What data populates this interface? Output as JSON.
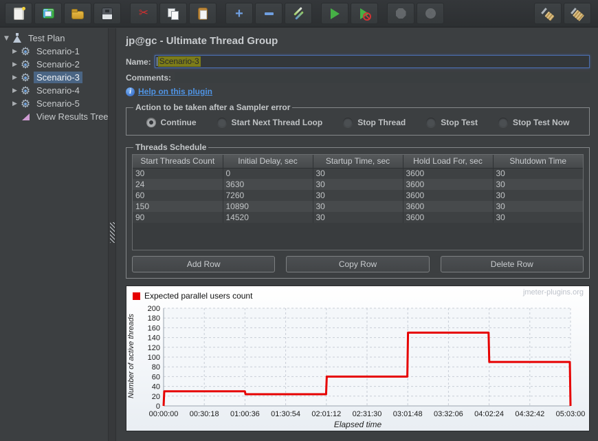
{
  "toolbar": {
    "buttons": [
      {
        "name": "new",
        "icon": "new-file-icon",
        "enabled": true
      },
      {
        "name": "templates",
        "icon": "templates-icon",
        "enabled": true
      },
      {
        "name": "open",
        "icon": "open-folder-icon",
        "enabled": true
      },
      {
        "name": "save",
        "icon": "save-icon",
        "enabled": true
      },
      {
        "separator": true
      },
      {
        "name": "cut",
        "icon": "cut-icon",
        "enabled": true
      },
      {
        "name": "copy",
        "icon": "copy-icon",
        "enabled": true
      },
      {
        "name": "paste",
        "icon": "paste-icon",
        "enabled": true
      },
      {
        "separator": true
      },
      {
        "name": "expand-all",
        "icon": "plus-icon",
        "enabled": true
      },
      {
        "name": "collapse-all",
        "icon": "minus-icon",
        "enabled": true
      },
      {
        "name": "toggle",
        "icon": "toggle-icon",
        "enabled": true
      },
      {
        "separator": true
      },
      {
        "name": "start",
        "icon": "start-icon",
        "enabled": true
      },
      {
        "name": "start-no-timers",
        "icon": "start-no-timers-icon",
        "enabled": true
      },
      {
        "separator": true
      },
      {
        "name": "stop",
        "icon": "stop-icon",
        "enabled": false
      },
      {
        "name": "shutdown",
        "icon": "shutdown-icon",
        "enabled": false
      },
      {
        "separator": true,
        "grow": true
      },
      {
        "name": "clear",
        "icon": "clear-icon",
        "enabled": true
      },
      {
        "name": "clear-all",
        "icon": "clear-all-icon",
        "enabled": true
      }
    ]
  },
  "tree": {
    "items": [
      {
        "label": "Test Plan",
        "icon": "test-plan-icon",
        "level": 0,
        "expandable": true,
        "expanded": true,
        "selected": false
      },
      {
        "label": "Scenario-1",
        "icon": "gear-icon",
        "level": 1,
        "expandable": true,
        "expanded": false,
        "selected": false
      },
      {
        "label": "Scenario-2",
        "icon": "gear-icon",
        "level": 1,
        "expandable": true,
        "expanded": false,
        "selected": false
      },
      {
        "label": "Scenario-3",
        "icon": "gear-icon",
        "level": 1,
        "expandable": true,
        "expanded": false,
        "selected": true
      },
      {
        "label": "Scenario-4",
        "icon": "gear-icon",
        "level": 1,
        "expandable": true,
        "expanded": false,
        "selected": false
      },
      {
        "label": "Scenario-5",
        "icon": "gear-icon",
        "level": 1,
        "expandable": true,
        "expanded": false,
        "selected": false
      },
      {
        "label": "View Results Tree",
        "icon": "results-tree-icon",
        "level": 1,
        "expandable": false,
        "expanded": false,
        "selected": false
      }
    ]
  },
  "main": {
    "title": "jp@gc - Ultimate Thread Group",
    "name_field": {
      "label": "Name:",
      "value": "Scenario-3",
      "text_selected": true
    },
    "comments_field": {
      "label": "Comments:",
      "value": ""
    },
    "help_link": "Help on this plugin",
    "action_group": {
      "title": "Action to be taken after a Sampler error",
      "options": [
        {
          "label": "Continue",
          "selected": true
        },
        {
          "label": "Start Next Thread Loop",
          "selected": false
        },
        {
          "label": "Stop Thread",
          "selected": false
        },
        {
          "label": "Stop Test",
          "selected": false
        },
        {
          "label": "Stop Test Now",
          "selected": false
        }
      ]
    },
    "schedule": {
      "title": "Threads Schedule",
      "columns": [
        "Start Threads Count",
        "Initial Delay, sec",
        "Startup Time, sec",
        "Hold Load For, sec",
        "Shutdown Time"
      ],
      "rows": [
        [
          "30",
          "0",
          "30",
          "3600",
          "30"
        ],
        [
          "24",
          "3630",
          "30",
          "3600",
          "30"
        ],
        [
          "60",
          "7260",
          "30",
          "3600",
          "30"
        ],
        [
          "150",
          "10890",
          "30",
          "3600",
          "30"
        ],
        [
          "90",
          "14520",
          "30",
          "3600",
          "30"
        ]
      ],
      "buttons": [
        "Add Row",
        "Copy Row",
        "Delete Row"
      ]
    }
  },
  "chart_data": {
    "type": "line",
    "legend": "Expected parallel users count",
    "watermark": "jmeter-plugins.org",
    "xlabel": "Elapsed time",
    "ylabel": "Number of active threads",
    "x_ticks": [
      "00:00:00",
      "00:30:18",
      "01:00:36",
      "01:30:54",
      "02:01:12",
      "02:31:30",
      "03:01:48",
      "03:32:06",
      "04:02:24",
      "04:32:42",
      "05:03:00"
    ],
    "x_range_seconds": [
      0,
      18180
    ],
    "y_ticks": [
      0,
      20,
      40,
      60,
      80,
      100,
      120,
      140,
      160,
      180,
      200
    ],
    "ylim": [
      0,
      200
    ],
    "grid": true,
    "legend_position": "top-left",
    "series": [
      {
        "name": "Expected parallel users count",
        "color": "#e60000",
        "points": [
          [
            0,
            0
          ],
          [
            30,
            30
          ],
          [
            3630,
            30
          ],
          [
            3660,
            24
          ],
          [
            7260,
            24
          ],
          [
            7290,
            60
          ],
          [
            10890,
            60
          ],
          [
            10920,
            150
          ],
          [
            14520,
            150
          ],
          [
            14550,
            90
          ],
          [
            18150,
            90
          ],
          [
            18180,
            0
          ]
        ]
      }
    ]
  },
  "colors": {
    "background": "#3c3f41",
    "tree_selection": "#4a6584",
    "name_selection_highlight": "#7c7c19",
    "link": "#4f93e3",
    "chart_line": "#e60000"
  }
}
